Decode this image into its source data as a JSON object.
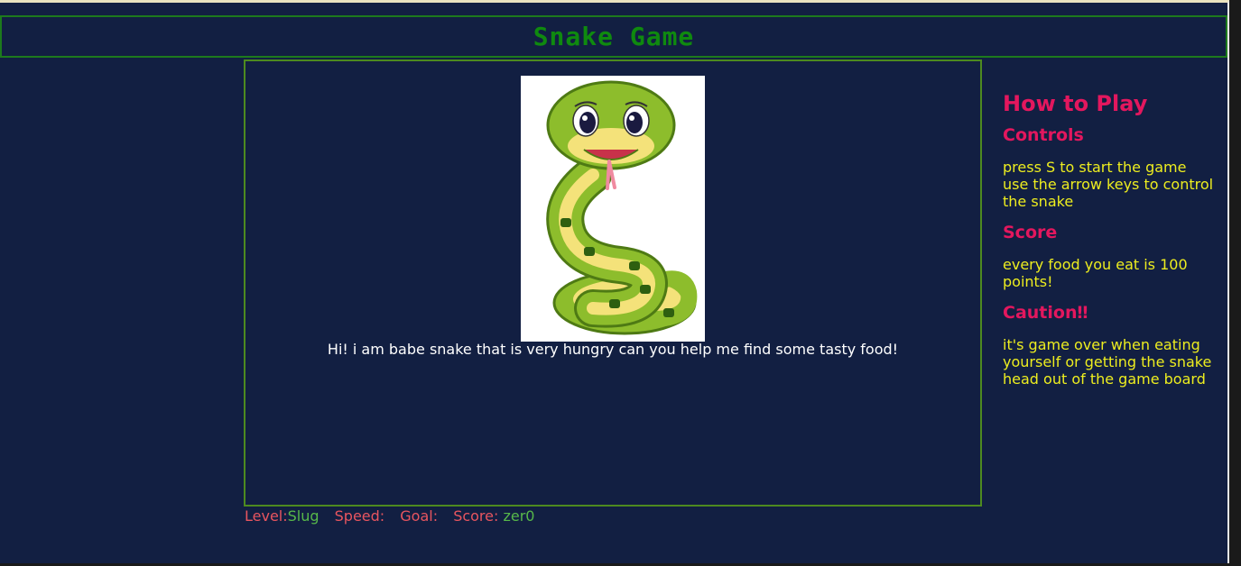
{
  "header": {
    "title": "Snake Game"
  },
  "board": {
    "intro_text": "Hi! i am babe snake that is very hungry can you help me find some tasty food!"
  },
  "status": {
    "level_label": "Level:",
    "level_value": "Slug",
    "speed_label": "Speed:",
    "speed_value": "",
    "goal_label": "Goal:",
    "goal_value": "",
    "score_label": "Score:",
    "score_value": "zer0"
  },
  "sidebar": {
    "title": "How to Play",
    "controls_heading": "Controls",
    "controls_line1": "press S to start the game",
    "controls_line2": "use the arrow keys to control the snake",
    "score_heading": "Score",
    "score_text": "every food you eat is 100 points!",
    "caution_heading": "Caution‼",
    "caution_text": "it's game over when eating yourself or getting the snake head out of the game board"
  },
  "colors": {
    "background": "#121f42",
    "title_green": "#0f8a0f",
    "heading_pink": "#e3175e",
    "text_yellow": "#eded1f",
    "status_label_red": "#e8555f",
    "status_value_green": "#57b84a"
  }
}
